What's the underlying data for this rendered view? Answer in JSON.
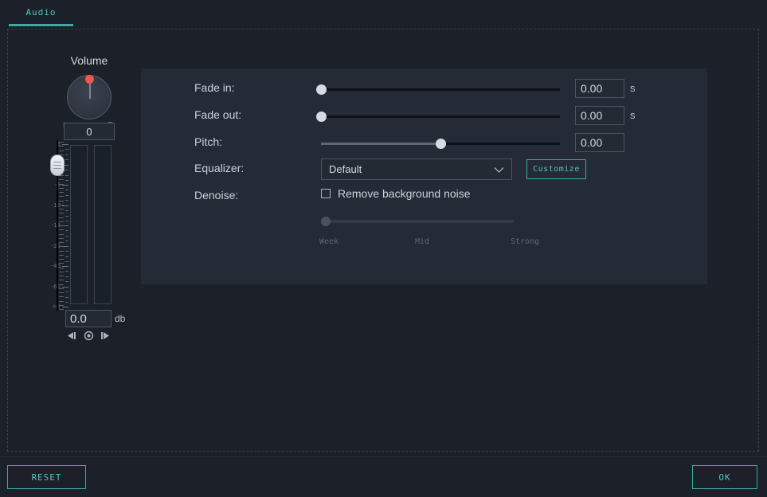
{
  "tabs": [
    {
      "label": "Audio",
      "active": true
    }
  ],
  "volume": {
    "title": "Volume",
    "knob_value": "0",
    "channel_left": "L",
    "channel_right": "R",
    "db_value": "0.0",
    "db_unit": "db",
    "scale_labels": [
      "6",
      "0",
      "-6",
      "-12",
      "-18",
      "-20",
      "-40",
      "-60",
      "-inf"
    ],
    "keyframe_buttons": [
      {
        "name": "prev-keyframe",
        "glyph": "◀❙"
      },
      {
        "name": "add-keyframe",
        "glyph": "◉"
      },
      {
        "name": "next-keyframe",
        "glyph": "❙▶"
      }
    ]
  },
  "form": {
    "fade_in": {
      "label": "Fade in:",
      "value": "0.00",
      "unit": "s",
      "slider_pct": 0
    },
    "fade_out": {
      "label": "Fade out:",
      "value": "0.00",
      "unit": "s",
      "slider_pct": 0
    },
    "pitch": {
      "label": "Pitch:",
      "value": "0.00",
      "unit": "",
      "slider_pct": 50
    },
    "equalizer": {
      "label": "Equalizer:",
      "selected": "Default",
      "customize_label": "Customize"
    },
    "denoise": {
      "label": "Denoise:",
      "checkbox_label": "Remove background noise",
      "checked": false,
      "slider_pct": 0,
      "marks": [
        "Week",
        "Mid",
        "Strong"
      ]
    }
  },
  "footer": {
    "reset_label": "RESET",
    "ok_label": "OK"
  },
  "colors": {
    "accent": "#4fc4bd",
    "knob_indicator": "#f2564f",
    "page_bg": "#1b2029",
    "panel_bg": "#242b36"
  }
}
